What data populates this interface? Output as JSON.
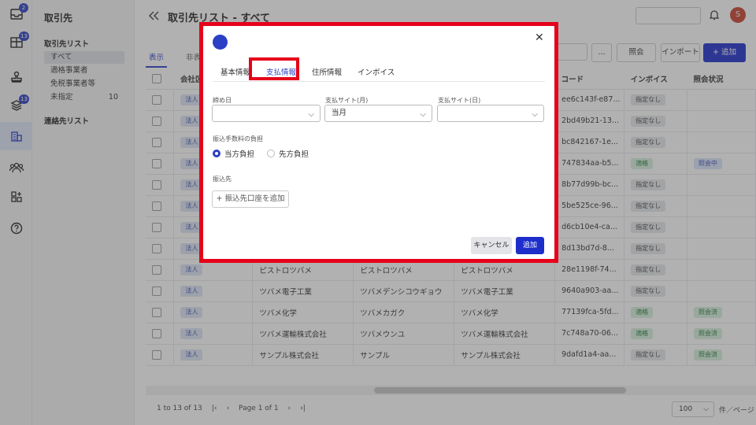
{
  "rail": {
    "items": [
      {
        "icon": "inbox-icon",
        "badge": "2"
      },
      {
        "icon": "table-icon",
        "badge": "13"
      },
      {
        "icon": "stamp-icon",
        "badge": ""
      },
      {
        "icon": "layers-icon",
        "badge": "13"
      },
      {
        "icon": "building-icon",
        "badge": ""
      },
      {
        "icon": "people-icon",
        "badge": ""
      },
      {
        "icon": "apps-icon",
        "badge": ""
      },
      {
        "icon": "help-icon",
        "badge": ""
      }
    ],
    "accent": "#2a3fc4"
  },
  "sidebar": {
    "title": "取引先",
    "group1": "取引先リスト",
    "items": [
      {
        "label": "すべて",
        "count": ""
      },
      {
        "label": "適格事業者",
        "count": ""
      },
      {
        "label": "免税事業者等",
        "count": ""
      },
      {
        "label": "未指定",
        "count": "10"
      }
    ],
    "group2": "連絡先リスト"
  },
  "header": {
    "title": "取引先リスト - すべて",
    "avatar": "S"
  },
  "toolbar": {
    "tabs": [
      "表示",
      "非表示"
    ],
    "more": "...",
    "inquiry": "照会",
    "import": "インポート",
    "add": "+ 追加"
  },
  "table": {
    "columns": [
      "",
      "会社区分",
      "",
      "",
      "",
      "コード",
      "インボイス",
      "照会状況"
    ],
    "rows": [
      {
        "type": "法人",
        "name": "",
        "kana": "",
        "display": "",
        "code": "ee6c143f-e87...",
        "invoice": "指定なし",
        "status": ""
      },
      {
        "type": "法人",
        "name": "",
        "kana": "",
        "display": "",
        "code": "2bd49b21-13...",
        "invoice": "指定なし",
        "status": ""
      },
      {
        "type": "法人",
        "name": "",
        "kana": "",
        "display": "",
        "code": "bc842167-1e...",
        "invoice": "指定なし",
        "status": ""
      },
      {
        "type": "法人",
        "name": "",
        "kana": "",
        "display": "",
        "code": "747834aa-b5...",
        "invoice": "適格",
        "status": "照会中"
      },
      {
        "type": "法人",
        "name": "",
        "kana": "",
        "display": "",
        "code": "8b77d99b-bc...",
        "invoice": "指定なし",
        "status": ""
      },
      {
        "type": "法人",
        "name": "",
        "kana": "",
        "display": "",
        "code": "5be525ce-96...",
        "invoice": "指定なし",
        "status": ""
      },
      {
        "type": "法人",
        "name": "",
        "kana": "",
        "display": "",
        "code": "d6cb10e4-ca...",
        "invoice": "指定なし",
        "status": ""
      },
      {
        "type": "法人",
        "name": "",
        "kana": "",
        "display": "",
        "code": "8d13bd7d-8...",
        "invoice": "指定なし",
        "status": ""
      },
      {
        "type": "法人",
        "name": "ピストロツバメ",
        "kana": "ピストロツバメ",
        "display": "ピストロツバメ",
        "code": "28e1198f-74...",
        "invoice": "指定なし",
        "status": ""
      },
      {
        "type": "法人",
        "name": "ツバメ電子工業",
        "kana": "ツバメデンシコウギョウ",
        "display": "ツバメ電子工業",
        "code": "9640a903-aa...",
        "invoice": "指定なし",
        "status": ""
      },
      {
        "type": "法人",
        "name": "ツバメ化学",
        "kana": "ツバメカガク",
        "display": "ツバメ化学",
        "code": "77139fca-5fd...",
        "invoice": "適格",
        "status": "照会済"
      },
      {
        "type": "法人",
        "name": "ツバメ運輸株式会社",
        "kana": "ツバメウンユ",
        "display": "ツバメ運輸株式会社",
        "code": "7c748a70-06...",
        "invoice": "適格",
        "status": "照会済"
      },
      {
        "type": "法人",
        "name": "サンプル株式会社",
        "kana": "サンプル",
        "display": "サンプル株式会社",
        "code": "9dafd1a4-aa...",
        "invoice": "指定なし",
        "status": "照会済"
      }
    ]
  },
  "pager": {
    "range": "1 to 13 of 13",
    "page": "Page 1 of 1",
    "per_page": "100",
    "per_page_label": "件／ページ"
  },
  "modal": {
    "tabs": [
      "基本情報",
      "支払情報",
      "住所情報",
      "インボイス"
    ],
    "closing_day_label": "締め日",
    "closing_day_value": "",
    "pay_month_label": "支払サイト(月)",
    "pay_month_value": "当月",
    "pay_day_label": "支払サイト(日)",
    "pay_day_value": "",
    "fee_label": "振込手数料の負担",
    "fee_option_1": "当方負担",
    "fee_option_2": "先方負担",
    "dest_label": "振込先",
    "add_account": "+ 振込先口座を追加",
    "cancel": "キャンセル",
    "add": "追加"
  }
}
